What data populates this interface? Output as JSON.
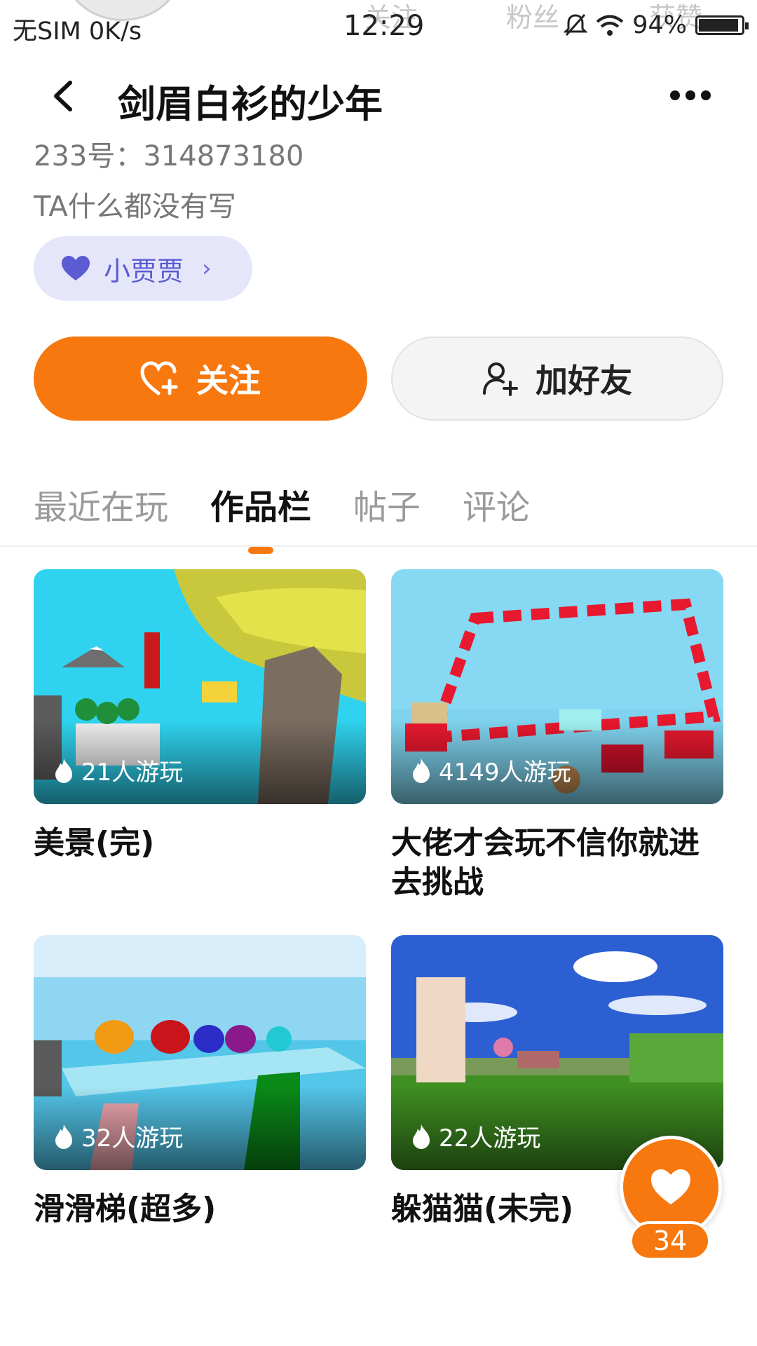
{
  "status_bar": {
    "carrier": "无SIM 0K/s",
    "time": "12:29",
    "battery": "94%",
    "battery_level": 0.94,
    "ghost_labels": [
      "关注",
      "粉丝",
      "获赞"
    ]
  },
  "header": {
    "back_icon": "chevron-left-icon",
    "title": "剑眉白衫的少年",
    "more_icon": "more-dots-icon"
  },
  "profile": {
    "uid": "233号：314873180",
    "bio": "TA什么都没有写",
    "badge": {
      "icon": "heart-icon",
      "label": "小贾贾",
      "chevron": "›"
    }
  },
  "actions": {
    "follow": {
      "icon": "heart-plus-icon",
      "label": "关注"
    },
    "add_friend": {
      "icon": "person-add-icon",
      "label": "加好友"
    }
  },
  "tabs": [
    {
      "label": "最近在玩",
      "active": false
    },
    {
      "label": "作品栏",
      "active": true
    },
    {
      "label": "帖子",
      "active": false
    },
    {
      "label": "评论",
      "active": false
    }
  ],
  "works": [
    {
      "title": "美景(完)",
      "plays": "21人游玩",
      "icon": "flame-icon"
    },
    {
      "title": "大佬才会玩不信你就进去挑战",
      "plays": "4149人游玩",
      "icon": "flame-icon"
    },
    {
      "title": "滑滑梯(超多)",
      "plays": "32人游玩",
      "icon": "flame-icon"
    },
    {
      "title": "躲猫猫(未完)",
      "plays": "22人游玩",
      "icon": "flame-icon"
    }
  ],
  "like": {
    "icon": "heart-icon",
    "count": "34"
  },
  "colors": {
    "accent": "#f7780f",
    "badge_bg": "#e5e6fa",
    "badge_fg": "#5b5bd2"
  }
}
